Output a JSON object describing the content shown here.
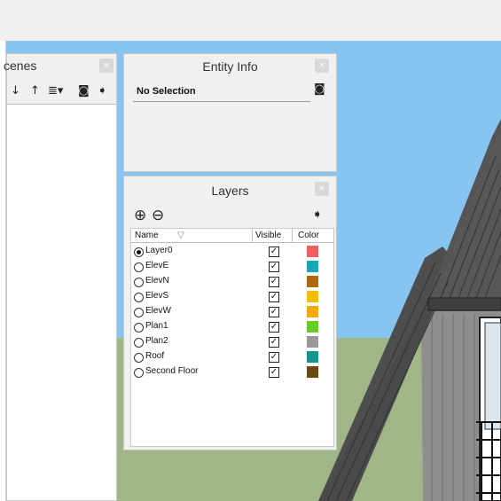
{
  "scenes_panel": {
    "title": "cenes",
    "close": "×"
  },
  "entity_info": {
    "title": "Entity Info",
    "status": "No Selection",
    "close": "×"
  },
  "layers_panel": {
    "title": "Layers",
    "close": "×",
    "add_icon": "⊕",
    "remove_icon": "⊖",
    "details_icon": "➧",
    "columns": {
      "name": "Name",
      "visible": "Visible",
      "color": "Color"
    },
    "rows": [
      {
        "name": "Layer0",
        "selected": true,
        "visible": true,
        "color": "#f06060"
      },
      {
        "name": "ElevE",
        "selected": false,
        "visible": true,
        "color": "#14a8b4"
      },
      {
        "name": "ElevN",
        "selected": false,
        "visible": true,
        "color": "#b0660a"
      },
      {
        "name": "ElevS",
        "selected": false,
        "visible": true,
        "color": "#f2bf00"
      },
      {
        "name": "ElevW",
        "selected": false,
        "visible": true,
        "color": "#f4a800"
      },
      {
        "name": "Plan1",
        "selected": false,
        "visible": true,
        "color": "#66cc22"
      },
      {
        "name": "Plan2",
        "selected": false,
        "visible": true,
        "color": "#999999"
      },
      {
        "name": "Roof",
        "selected": false,
        "visible": true,
        "color": "#12968a"
      },
      {
        "name": "Second Floor",
        "selected": false,
        "visible": true,
        "color": "#6b4a0e"
      }
    ]
  },
  "colors": {
    "sky": "#87c4ef",
    "ground": "#9fb689"
  }
}
